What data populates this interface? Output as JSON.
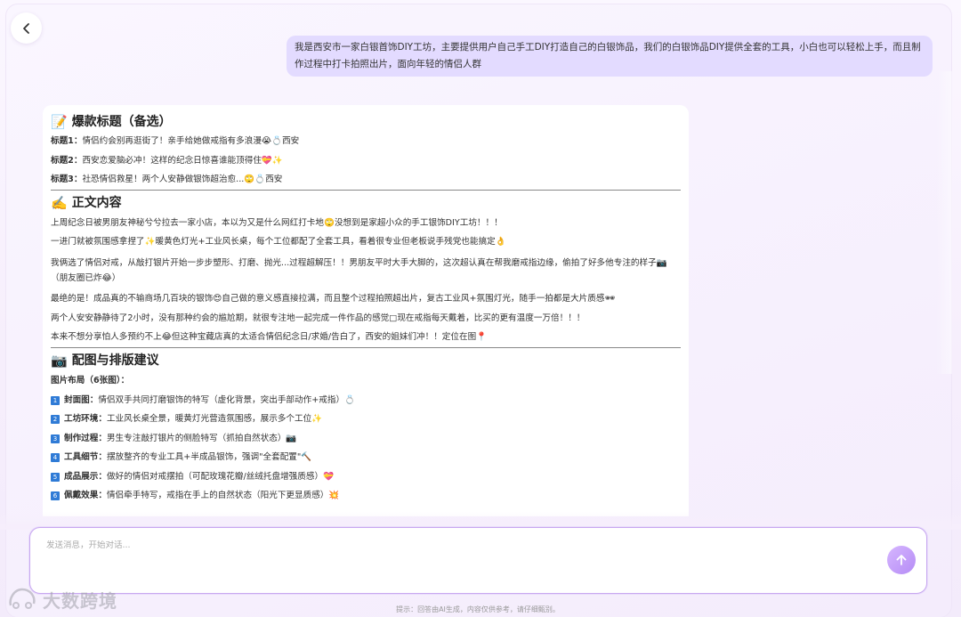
{
  "user_message": "我是西安市一家白银首饰DIY工坊，主要提供用户自己手工DIY打造自己的白银饰品，我们的白银饰品DIY提供全套的工具，小白也可以轻松上手，而且制作过程中打卡拍照出片，面向年轻的情侣人群",
  "ai_reply": {
    "titles_section": {
      "emoji": "📝",
      "heading": "爆款标题（备选）",
      "items": [
        {
          "label": "标题1：",
          "text": "情侣约会别再逛街了！亲手给她做戒指有多浪漫😭💍西安"
        },
        {
          "label": "标题2：",
          "text": "西安恋爱脑必冲！这样的纪念日惊喜谁能顶得住💝✨"
        },
        {
          "label": "标题3：",
          "text": "社恐情侣救星！两个人安静做银饰超治愈...🙄💍西安"
        }
      ]
    },
    "body_section": {
      "emoji": "✍️",
      "heading": "正文内容",
      "paragraphs": [
        "上周纪念日被男朋友神秘兮兮拉去一家小店，本以为又是什么网红打卡地🙄没想到是家超小众的手工银饰DIY工坊！！！",
        "一进门就被氛围感拿捏了✨暖黄色灯光+工业风长桌，每个工位都配了全套工具，看着很专业但老板说手残党也能搞定👌",
        "我俩选了情侣对戒，从敲打银片开始一步步塑形、打磨、抛光...过程超解压！！男朋友平时大手大脚的，这次超认真在帮我磨戒指边缘，偷拍了好多他专注的样子📷（朋友圈已炸😂）",
        "最绝的是！成品真的不输商场几百块的银饰😍自己做的意义感直接拉满，而且整个过程拍照超出片，复古工业风+氛围灯光，随手一拍都是大片质感🕶",
        "两个人安安静静待了2小时，没有那种约会的尴尬期，就很专注地一起完成一件作品的感觉□现在戒指每天戴着，比买的更有温度一万倍！！！",
        "本来不想分享怕人多预约不上😂但这种宝藏店真的太适合情侣纪念日/求婚/告白了，西安的姐妹们冲！！定位在图📍"
      ]
    },
    "layout_section": {
      "emoji": "📷",
      "heading": "配图与排版建议",
      "subheading": "图片布局（6张图）：",
      "items": [
        {
          "num": "1",
          "label": "封面图：",
          "text": "情侣双手共同打磨银饰的特写（虚化背景，突出手部动作+戒指）💍"
        },
        {
          "num": "2",
          "label": "工坊环境：",
          "text": "工业风长桌全景，暖黄灯光营造氛围感，展示多个工位✨"
        },
        {
          "num": "3",
          "label": "制作过程：",
          "text": "男生专注敲打银片的侧脸特写（抓拍自然状态）📷"
        },
        {
          "num": "4",
          "label": "工具细节：",
          "text": "摆放整齐的专业工具+半成品银饰，强调\"全套配置\"🔨"
        },
        {
          "num": "5",
          "label": "成品展示：",
          "text": "做好的情侣对戒摆拍（可配玫瑰花瓣/丝绒托盘增强质感）💝"
        },
        {
          "num": "6",
          "label": "佩戴效果：",
          "text": "情侣牵手特写，戒指在手上的自然状态（阳光下更显质感）💥"
        }
      ]
    }
  },
  "input": {
    "placeholder": "发送消息，开始对话..."
  },
  "footer_hint": "提示：回答由AI生成，内容仅供参考，请仔细甄别。",
  "watermark_text": "大数跨境",
  "colors": {
    "accent": "#b58cf5",
    "user_bubble": "#e3dbff",
    "number_badge": "#2f7bd6"
  }
}
